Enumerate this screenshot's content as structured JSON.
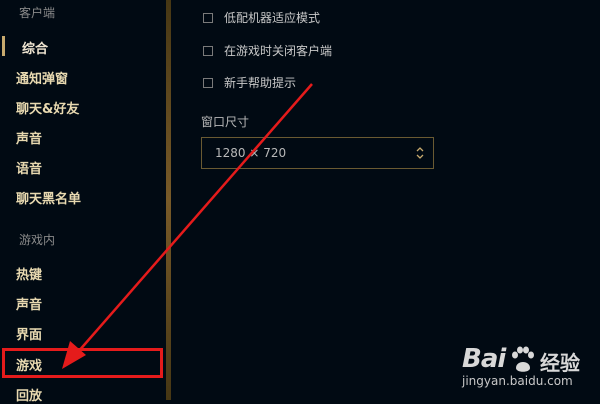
{
  "sidebar": {
    "section_client": "客户端",
    "section_ingame": "游戏内",
    "client_items": [
      {
        "label": "综合"
      },
      {
        "label": "通知弹窗"
      },
      {
        "label": "聊天&好友"
      },
      {
        "label": "声音"
      },
      {
        "label": "语音"
      },
      {
        "label": "聊天黑名单"
      }
    ],
    "ingame_items": [
      {
        "label": "热键"
      },
      {
        "label": "声音"
      },
      {
        "label": "界面"
      },
      {
        "label": "游戏"
      },
      {
        "label": "回放"
      }
    ]
  },
  "main": {
    "checkboxes": [
      {
        "label": "低配机器适应模式",
        "checked": false
      },
      {
        "label": "在游戏时关闭客户端",
        "checked": false
      },
      {
        "label": "新手帮助提示",
        "checked": false
      }
    ],
    "window_size": {
      "label": "窗口尺寸",
      "value": "1280 × 720"
    }
  },
  "annotation": {
    "highlight_target": "游戏",
    "color": "#e51b1b"
  },
  "watermark": {
    "brand_bai": "Bai",
    "brand_jingyan": "经验",
    "url": "jingyan.baidu.com"
  },
  "colors": {
    "background": "#010a13",
    "gold": "#785a28",
    "accent": "#c8aa6e"
  }
}
